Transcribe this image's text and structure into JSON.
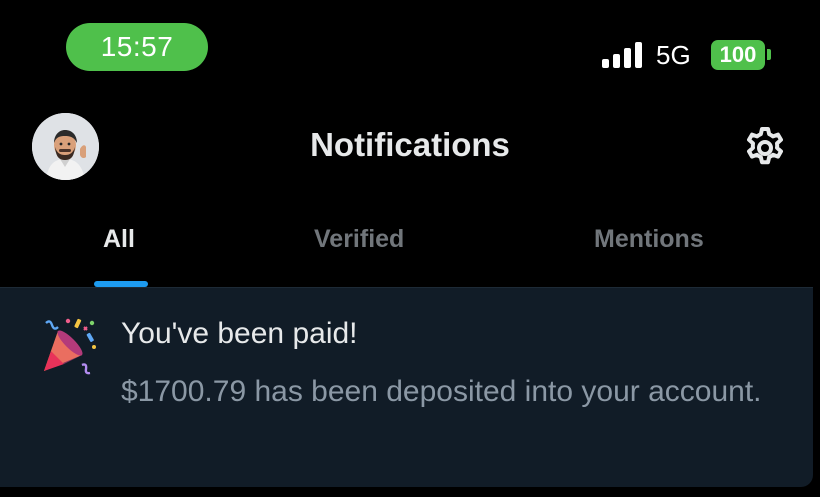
{
  "status_bar": {
    "time": "15:57",
    "network": "5G",
    "battery": "100",
    "accent_color": "#4fc04b"
  },
  "header": {
    "title": "Notifications",
    "avatar_icon": "user-avatar",
    "settings_icon": "gear-icon"
  },
  "tabs": [
    {
      "label": "All",
      "active": true
    },
    {
      "label": "Verified",
      "active": false
    },
    {
      "label": "Mentions",
      "active": false
    }
  ],
  "notification": {
    "icon": "party-popper-icon",
    "title": "You've been paid!",
    "body": "$1700.79 has been deposited into your account."
  },
  "colors": {
    "background": "#000000",
    "card": "#111c27",
    "tab_indicator": "#1d9bf0",
    "muted_text": "#71767b"
  }
}
